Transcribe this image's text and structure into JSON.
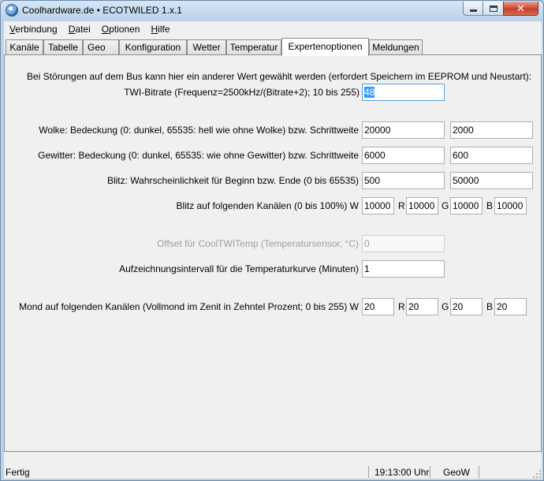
{
  "window": {
    "title": "Coolhardware.de • ECOTWILED 1.x.1"
  },
  "menu": [
    {
      "pre": "",
      "ul": "V",
      "post": "erbindung"
    },
    {
      "pre": "",
      "ul": "D",
      "post": "atei"
    },
    {
      "pre": "",
      "ul": "O",
      "post": "ptionen"
    },
    {
      "pre": "",
      "ul": "H",
      "post": "ilfe"
    }
  ],
  "tabs": [
    "Kanäle",
    "Tabelle",
    "Geo",
    "Konfiguration",
    "Wetter",
    "Temperatur",
    "Expertenoptionen",
    "Meldungen"
  ],
  "active_tab": "Expertenoptionen",
  "expert": {
    "bus_note": "Bei Störungen auf dem Bus kann hier ein anderer Wert gewählt werden (erfordert Speichern im EEPROM und Neustart):",
    "twi_label": "TWI-Bitrate (Frequenz=2500kHz/(Bitrate+2); 10 bis 255)",
    "twi_value": "48",
    "wolke_label": "Wolke: Bedeckung (0: dunkel, 65535: hell wie ohne Wolke) bzw. Schrittweite",
    "wolke_value": "20000",
    "wolke_step": "2000",
    "gewitter_label": "Gewitter: Bedeckung (0: dunkel, 65535: wie ohne Gewitter) bzw. Schrittweite",
    "gewitter_value": "6000",
    "gewitter_step": "600",
    "blitz_label": "Blitz: Wahrscheinlichkeit für Beginn bzw. Ende (0 bis 65535)",
    "blitz_begin": "500",
    "blitz_end": "50000",
    "blitz_channels_label": "Blitz auf folgenden Kanälen (0 bis 100%) W",
    "blitz_w": "10000",
    "blitz_r": "10000",
    "blitz_g": "10000",
    "blitz_b": "10000",
    "offset_label": "Offset für CoolTWITemp (Temperatursensor, °C)",
    "offset_value": "0",
    "interval_label": "Aufzeichnungsintervall für die Temperaturkurve (Minuten)",
    "interval_value": "1",
    "mond_label": "Mond auf folgenden Kanälen (Vollmond im Zenit in Zehntel Prozent; 0 bis 255) W",
    "mond_w": "20",
    "mond_r": "20",
    "mond_g": "20",
    "mond_b": "20",
    "ch_r": "R",
    "ch_g": "G",
    "ch_b": "B"
  },
  "status": {
    "state": "Fertig",
    "time": "19:13:00 Uhr",
    "mode": "GeoW"
  }
}
